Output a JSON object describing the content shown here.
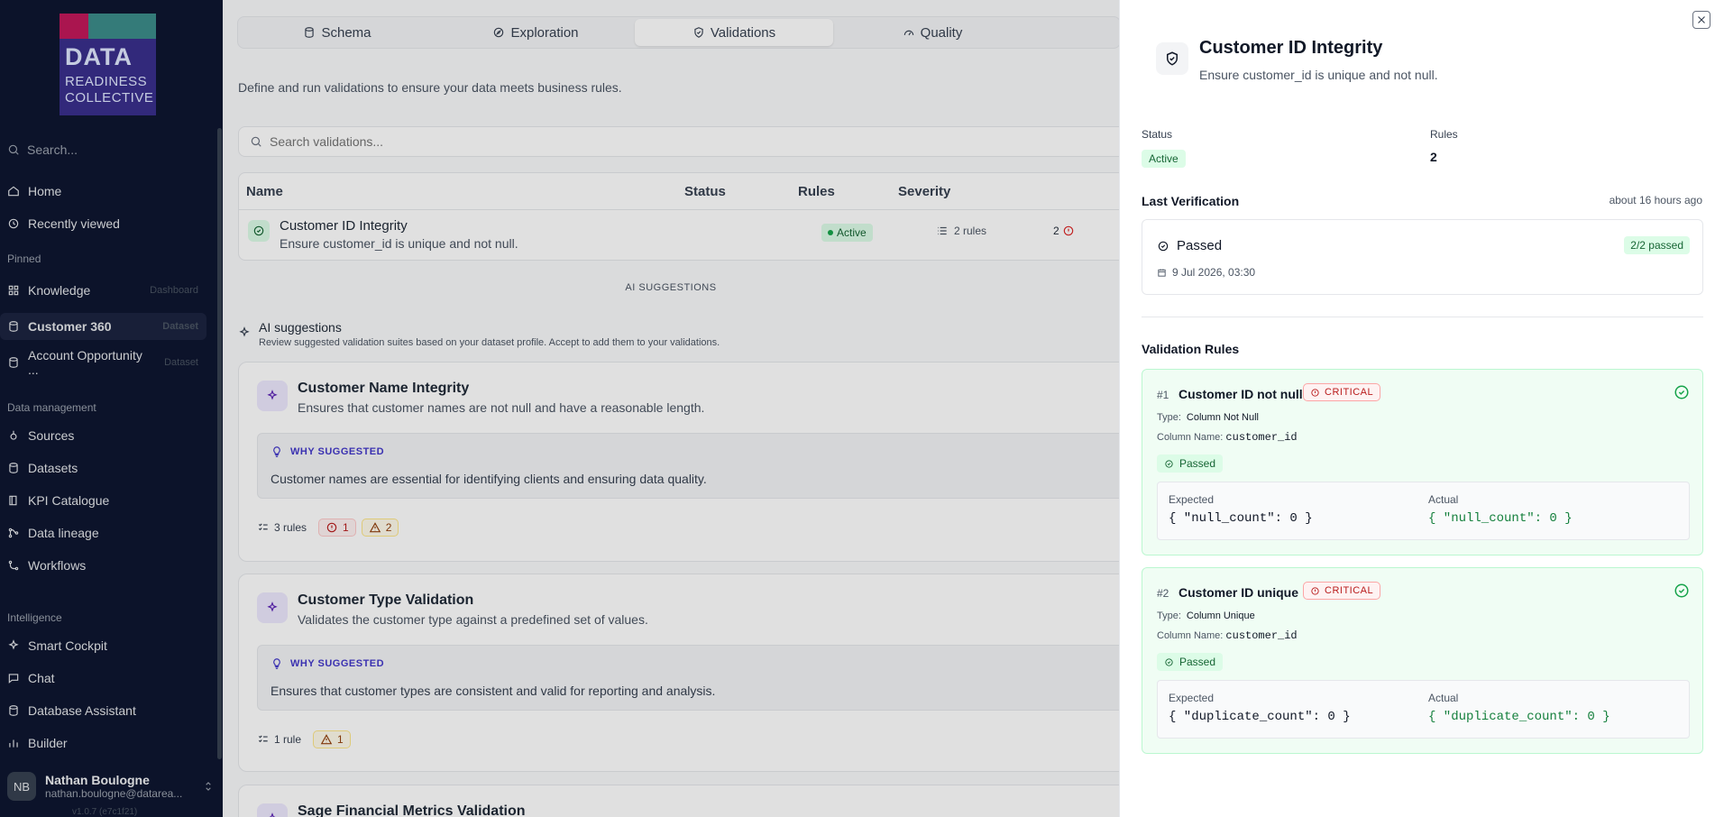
{
  "logo": {
    "line1": "DATA",
    "line2": "READINESS",
    "line3": "COLLECTIVE"
  },
  "sidebar": {
    "search_placeholder": "Search...",
    "home": "Home",
    "recent": "Recently viewed",
    "pinned_label": "Pinned",
    "pinned": [
      {
        "label": "Knowledge",
        "tag": "Dashboard"
      },
      {
        "label": "Customer 360",
        "tag": "Dataset"
      },
      {
        "label": "Account Opportunity ...",
        "tag": "Dataset"
      }
    ],
    "data_mgmt_label": "Data management",
    "data_mgmt": [
      "Sources",
      "Datasets",
      "KPI Catalogue",
      "Data lineage",
      "Workflows"
    ],
    "intel_label": "Intelligence",
    "intel": [
      "Smart Cockpit",
      "Chat",
      "Database Assistant",
      "Builder"
    ],
    "user": {
      "initials": "NB",
      "name": "Nathan Boulogne",
      "email": "nathan.boulogne@datarea..."
    },
    "version": "v1.0.7 (e7c1f21)"
  },
  "main": {
    "tabs": [
      "Schema",
      "Exploration",
      "Validations",
      "Quality"
    ],
    "description": "Define and run validations to ensure your data meets business rules.",
    "search_placeholder": "Search validations...",
    "columns": {
      "name": "Name",
      "status": "Status",
      "rules": "Rules",
      "severity": "Severity"
    },
    "row": {
      "name": "Customer ID Integrity",
      "desc": "Ensure customer_id is unique and not null.",
      "status": "Active",
      "rules": "2 rules",
      "severity": "2"
    },
    "divider": "AI SUGGESTIONS",
    "ai_title": "AI suggestions",
    "ai_sub": "Review suggested validation suites based on your dataset profile. Accept to add them to your validations.",
    "why_label": "WHY SUGGESTED",
    "suggestions": [
      {
        "title": "Customer Name Integrity",
        "desc": "Ensures that customer names are not null and have a reasonable length.",
        "why": "Customer names are essential for identifying clients and ensuring data quality.",
        "rules": "3 rules",
        "critical": "1",
        "warning": "2"
      },
      {
        "title": "Customer Type Validation",
        "desc": "Validates the customer type against a predefined set of values.",
        "why": "Ensures that customer types are consistent and valid for reporting and analysis.",
        "rules": "1 rule",
        "warning": "1"
      },
      {
        "title": "Sage Financial Metrics Validation"
      }
    ]
  },
  "panel": {
    "title": "Customer ID Integrity",
    "subtitle": "Ensure customer_id is unique and not null.",
    "status_label": "Status",
    "status": "Active",
    "rules_label": "Rules",
    "rules_count": "2",
    "last_verification_label": "Last Verification",
    "last_verification_time": "about 16 hours ago",
    "verification": {
      "result": "Passed",
      "date": "9 Jul 2026, 03:30",
      "summary": "2/2 passed"
    },
    "validation_rules_label": "Validation Rules",
    "rules": [
      {
        "num": "#1",
        "name": "Customer ID not null",
        "severity": "CRITICAL",
        "type_label": "Type:",
        "type": "Column Not Null",
        "col_label": "Column Name:",
        "col": "customer_id",
        "result": "Passed",
        "expected_label": "Expected",
        "expected": "{ \"null_count\": 0 }",
        "actual_label": "Actual",
        "actual": "{ \"null_count\": 0 }"
      },
      {
        "num": "#2",
        "name": "Customer ID unique",
        "severity": "CRITICAL",
        "type_label": "Type:",
        "type": "Column Unique",
        "col_label": "Column Name:",
        "col": "customer_id",
        "result": "Passed",
        "expected_label": "Expected",
        "expected": "{ \"duplicate_count\": 0 }",
        "actual_label": "Actual",
        "actual": "{ \"duplicate_count\": 0 }"
      }
    ]
  }
}
